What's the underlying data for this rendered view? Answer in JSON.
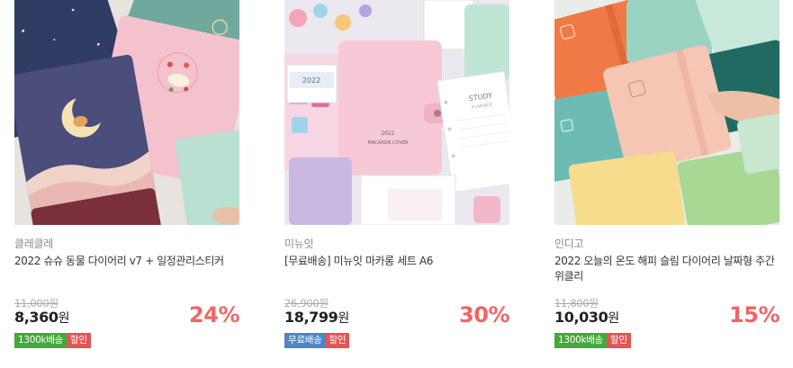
{
  "products": [
    {
      "brand": "클레클레",
      "title": "2022 슈슈 동물 다이어리 v7 + 일정관리스티커",
      "original_price": "11,000원",
      "price": "8,360",
      "currency": "원",
      "discount": "24%",
      "badges": [
        "1300k배송",
        "할인"
      ],
      "image_desc": "pastel night-sky animal diaries"
    },
    {
      "brand": "미뉴잇",
      "title": "[무료배송] 미뉴잇 마카롱 세트 A6",
      "original_price": "26,900원",
      "price": "18,799",
      "currency": "원",
      "discount": "30%",
      "badges": [
        "무료배송",
        "할인"
      ],
      "image_desc": "pink macaron cover planner set"
    },
    {
      "brand": "인디고",
      "title": "2022 오늘의 온도 해피 슬림 다이어리 날짜형 주간 위클리",
      "original_price": "11,800원",
      "price": "10,030",
      "currency": "원",
      "discount": "15%",
      "badges": [
        "1300k배송",
        "할인"
      ],
      "image_desc": "pastel slim diaries with band"
    }
  ],
  "image_texts": {
    "p2_year": "2022",
    "p2_cover": "MACARON COVER",
    "p2_study": "STUDY",
    "p2_planner": "PLANNER",
    "p2_calendar": "2022"
  },
  "colors": {
    "discount": "#ee6666",
    "badge_green": "#44a83c",
    "badge_blue": "#4a86c8",
    "badge_red": "#e25555"
  }
}
